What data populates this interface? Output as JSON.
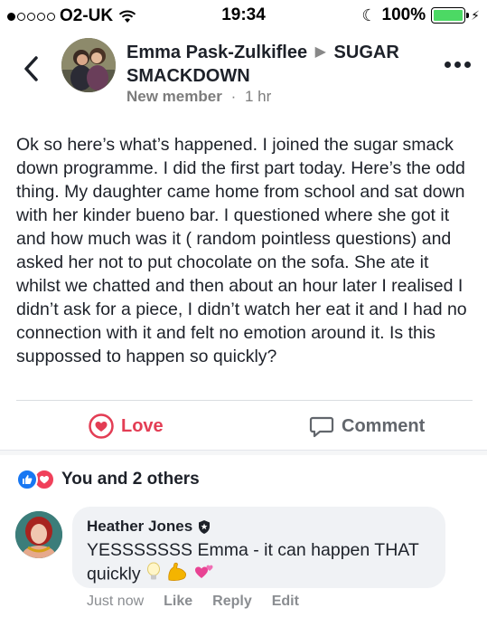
{
  "status_bar": {
    "carrier": "O2-UK",
    "time": "19:34",
    "battery": "100%",
    "signal_bars_filled": 1,
    "signal_bars_total": 5
  },
  "post": {
    "author": "Emma Pask-Zulkiflee",
    "group": "SUGAR SMACKDOWN",
    "role": "New member",
    "separator": "·",
    "time": "1 hr",
    "body": "Ok so here’s what’s happened. I joined the sugar smack down programme. I did the first part today. Here’s the odd thing. My daughter came home from school and sat down with her kinder bueno bar. I questioned where she got it and how much was it ( random pointless questions) and asked her not to put chocolate on the sofa.  She ate it whilst we chatted and then about an hour later I realised I didn’t ask for a piece, I didn’t  watch her eat it and I had no connection with it and felt no emotion around it. Is this suppossed to happen so quickly?"
  },
  "actions": {
    "love_label": "Love",
    "comment_label": "Comment"
  },
  "reactions": {
    "summary": "You and 2 others"
  },
  "comment": {
    "author": "Heather Jones",
    "text": "YESSSSSSS Emma - it can happen THAT quickly",
    "time": "Just now",
    "like_label": "Like",
    "reply_label": "Reply",
    "edit_label": "Edit"
  },
  "colors": {
    "love": "#e33d54",
    "like_blue": "#1877f2",
    "battery_green": "#4cd964",
    "meta_gray": "#8a8d91"
  }
}
